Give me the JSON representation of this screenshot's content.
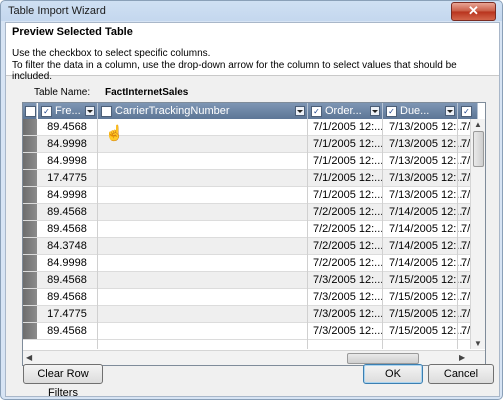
{
  "window": {
    "title": "Table Import Wizard",
    "close_label": "✕"
  },
  "header": {
    "section_title": "Preview Selected Table",
    "instruction_1": "Use the checkbox to select specific columns.",
    "instruction_2": "To filter the data in a column, use the drop-down arrow  for the column to select values that should be included."
  },
  "table_name": {
    "label": "Table Name:",
    "value": "FactInternetSales"
  },
  "columns": [
    {
      "label": "Fre...",
      "checked": true
    },
    {
      "label": "CarrierTrackingNumber",
      "checked": false
    },
    {
      "label": "Order...",
      "checked": true
    },
    {
      "label": "Due...",
      "checked": true
    },
    {
      "label": "",
      "checked": true
    }
  ],
  "rows": [
    [
      "89.4568",
      "",
      "7/1/2005 12:...",
      "7/13/2005 12:...",
      "7/8"
    ],
    [
      "84.9998",
      "",
      "7/1/2005 12:...",
      "7/13/2005 12:...",
      "7/8"
    ],
    [
      "84.9998",
      "",
      "7/1/2005 12:...",
      "7/13/2005 12:...",
      "7/8"
    ],
    [
      "17.4775",
      "",
      "7/1/2005 12:...",
      "7/13/2005 12:...",
      "7/8"
    ],
    [
      "84.9998",
      "",
      "7/1/2005 12:...",
      "7/13/2005 12:...",
      "7/8"
    ],
    [
      "89.4568",
      "",
      "7/2/2005 12:...",
      "7/14/2005 12:...",
      "7/9"
    ],
    [
      "89.4568",
      "",
      "7/2/2005 12:...",
      "7/14/2005 12:...",
      "7/9"
    ],
    [
      "84.3748",
      "",
      "7/2/2005 12:...",
      "7/14/2005 12:...",
      "7/9"
    ],
    [
      "84.9998",
      "",
      "7/2/2005 12:...",
      "7/14/2005 12:...",
      "7/9"
    ],
    [
      "89.4568",
      "",
      "7/3/2005 12:...",
      "7/15/2005 12:...",
      "7/1"
    ],
    [
      "89.4568",
      "",
      "7/3/2005 12:...",
      "7/15/2005 12:...",
      "7/1"
    ],
    [
      "17.4775",
      "",
      "7/3/2005 12:...",
      "7/15/2005 12:...",
      "7/1"
    ],
    [
      "89.4568",
      "",
      "7/3/2005 12:...",
      "7/15/2005 12:...",
      "7/1"
    ]
  ],
  "buttons": {
    "clear_filters": "Clear Row Filters",
    "ok": "OK",
    "cancel": "Cancel"
  },
  "icons": {
    "close": "close-icon",
    "dropdown": "chevron-down-icon",
    "pointer": "hand-pointer-icon"
  },
  "colors": {
    "header_bg": "#6b84a3",
    "alt_row": "#efefef",
    "close_bg": "#c85a43"
  }
}
